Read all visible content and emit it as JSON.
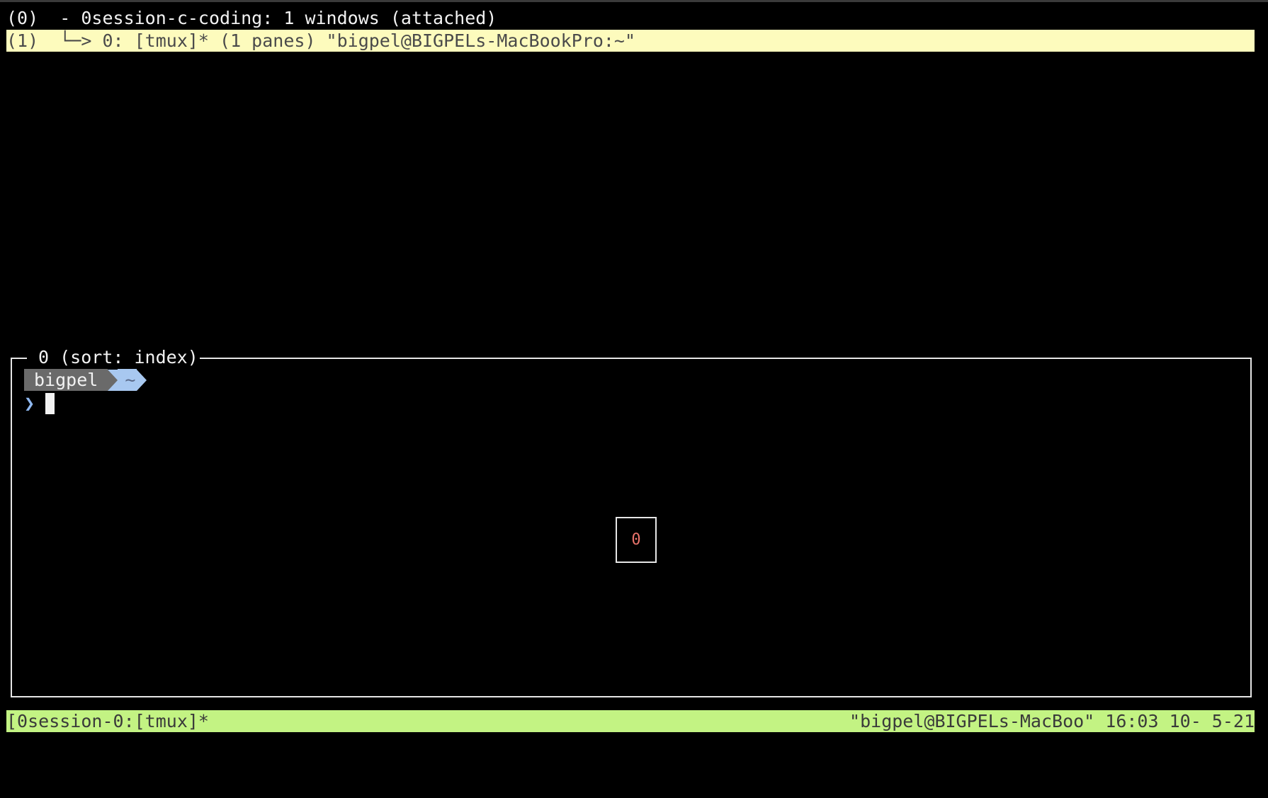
{
  "tree": {
    "rows": [
      {
        "index": "(0)",
        "text": "  - 0session-c-coding: 1 windows (attached)"
      },
      {
        "index": "(1)",
        "text": "  └─> 0: [tmux]* (1 panes) \"bigpel@BIGPELs-MacBookPro:~\""
      }
    ]
  },
  "preview": {
    "title": "0 (sort: index)",
    "prompt_user": "bigpel",
    "prompt_dir": "~",
    "prompt_char": "❯",
    "pane_number": "0"
  },
  "status_bar": {
    "left": "[0session-0:[tmux]*",
    "right": "\"bigpel@BIGPELs-MacBoo\" 16:03 10- 5-21"
  },
  "colors": {
    "selected_row_bg": "#fdfbbd",
    "status_bar_bg": "#c3f383",
    "pane_number": "#e8736b",
    "prompt_dir_bg": "#a8c8f0",
    "prompt_user_bg": "#6a6a6a"
  }
}
